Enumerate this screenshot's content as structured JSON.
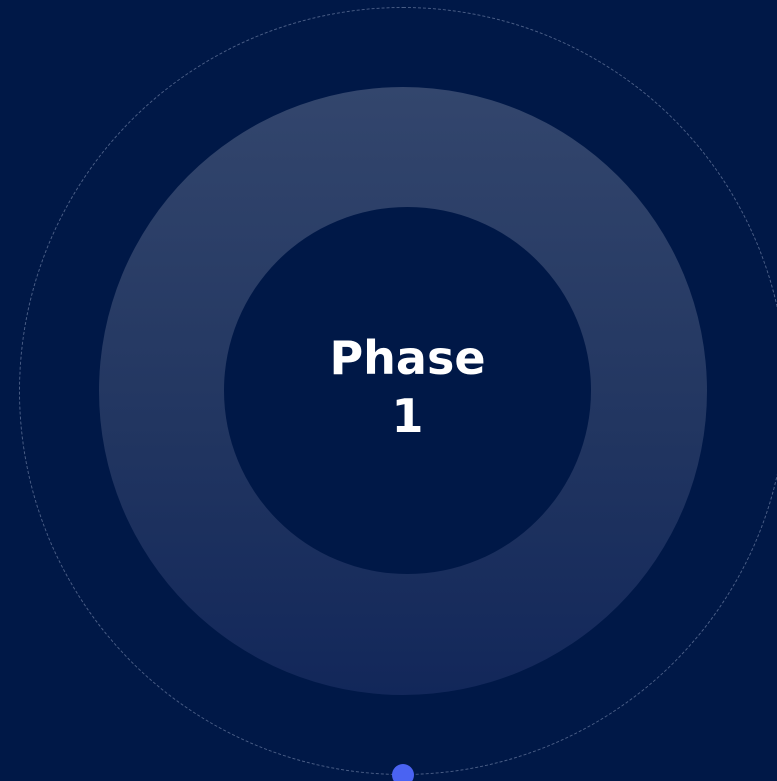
{
  "phase": {
    "word": "Phase",
    "number": "1"
  },
  "colors": {
    "background": "#001847",
    "ring_top": "#33466d",
    "ring_bottom": "#12275a",
    "orbit_dash": "#4a5e86",
    "indicator": "#4a63f2",
    "text": "#ffffff"
  }
}
